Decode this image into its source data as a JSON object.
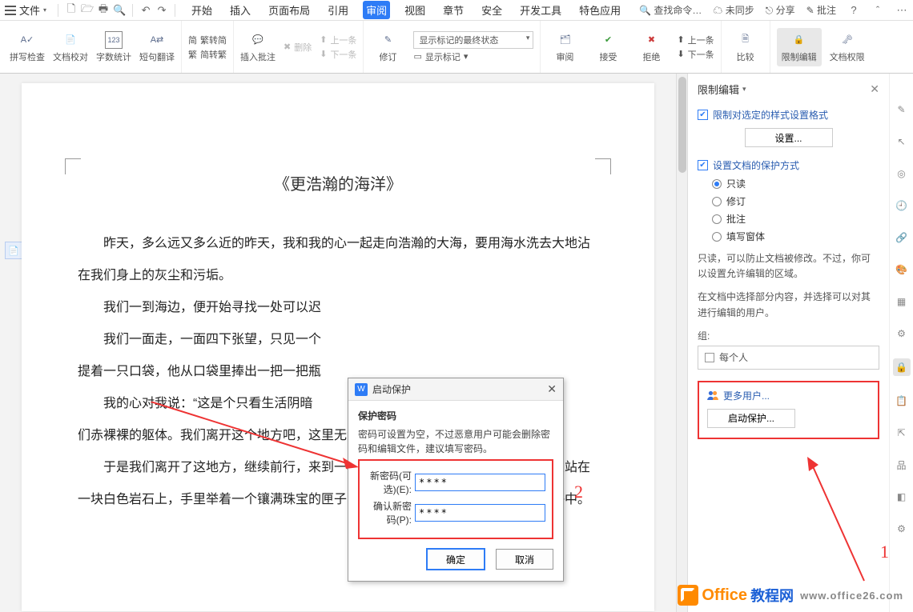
{
  "menubar": {
    "file": "文件",
    "tabs": [
      "开始",
      "插入",
      "页面布局",
      "引用",
      "审阅",
      "视图",
      "章节",
      "安全",
      "开发工具",
      "特色应用"
    ],
    "active_tab_index": 4,
    "search_placeholder": "查找命令…",
    "right": {
      "sync": "未同步",
      "share": "分享",
      "annotate": "批注"
    }
  },
  "ribbon": {
    "spellcheck": "拼写检查",
    "proof": "文档校对",
    "wordcount": "字数统计",
    "translate": "短句翻译",
    "t2s": "繁转简",
    "s2t": "简转繁",
    "insert_comment": "插入批注",
    "delete": "删除",
    "prev_comment": "上一条",
    "next_comment": "下一条",
    "track": "修订",
    "markup_select": "显示标记的最终状态",
    "show_markup": "显示标记",
    "review": "审阅",
    "accept": "接受",
    "reject": "拒绝",
    "prev_change": "上一条",
    "next_change": "下一条",
    "compare": "比较",
    "restrict": "限制编辑",
    "permissions": "文档权限"
  },
  "document": {
    "title": "《更浩瀚的海洋》",
    "p1": "昨天，多么远又多么近的昨天，我和我的心一起走向浩瀚的大海，要用海水洗去大地沾在我们身上的灰尘和污垢。",
    "p2": "我们一到海边，便开始寻找一处可以迟",
    "p3a": "我们一面走，一面四下张望，只见一个",
    "p3b": "提着一只口袋，他从口袋里捧出一把一把瓶",
    "p4a": "我的心对我说：“这是个只看生活阴暗",
    "p4b": "们赤裸裸的躯体。我们离开这个地方吧，这里无法洗浴。”",
    "p5": "于是我们离开了这地方，继续前行，来到一棵长在海边的白杨树下。只见一个男人站在一块白色岩石上，手里举着一个镶满珠宝的匣子，他从匣中取出一块一块的糖，抛入海中。"
  },
  "dialog": {
    "title": "启动保护",
    "section": "保护密码",
    "hint": "密码可设置为空，不过恶意用户可能会删除密码和编辑文件，建议填写密码。",
    "new_pwd_label": "新密码(可选)(E):",
    "confirm_pwd_label": "确认新密码(P):",
    "pwd_value": "****",
    "ok": "确定",
    "cancel": "取消"
  },
  "panel": {
    "title": "限制编辑",
    "chk_style": "限制对选定的样式设置格式",
    "settings_btn": "设置...",
    "chk_protect": "设置文档的保护方式",
    "radios": [
      "只读",
      "修订",
      "批注",
      "填写窗体"
    ],
    "radio_selected": 0,
    "hint1": "只读，可以防止文档被修改。不过，你可以设置允许编辑的区域。",
    "hint2": "在文档中选择部分内容，并选择可以对其进行编辑的用户。",
    "group_label": "组:",
    "everyone": "每个人",
    "more_users": "更多用户...",
    "start_btn": "启动保护..."
  },
  "annotations": {
    "num1": "1",
    "num2": "2"
  },
  "watermark": {
    "brand": "Office",
    "suffix": "教程网",
    "url": "www.office26.com"
  }
}
